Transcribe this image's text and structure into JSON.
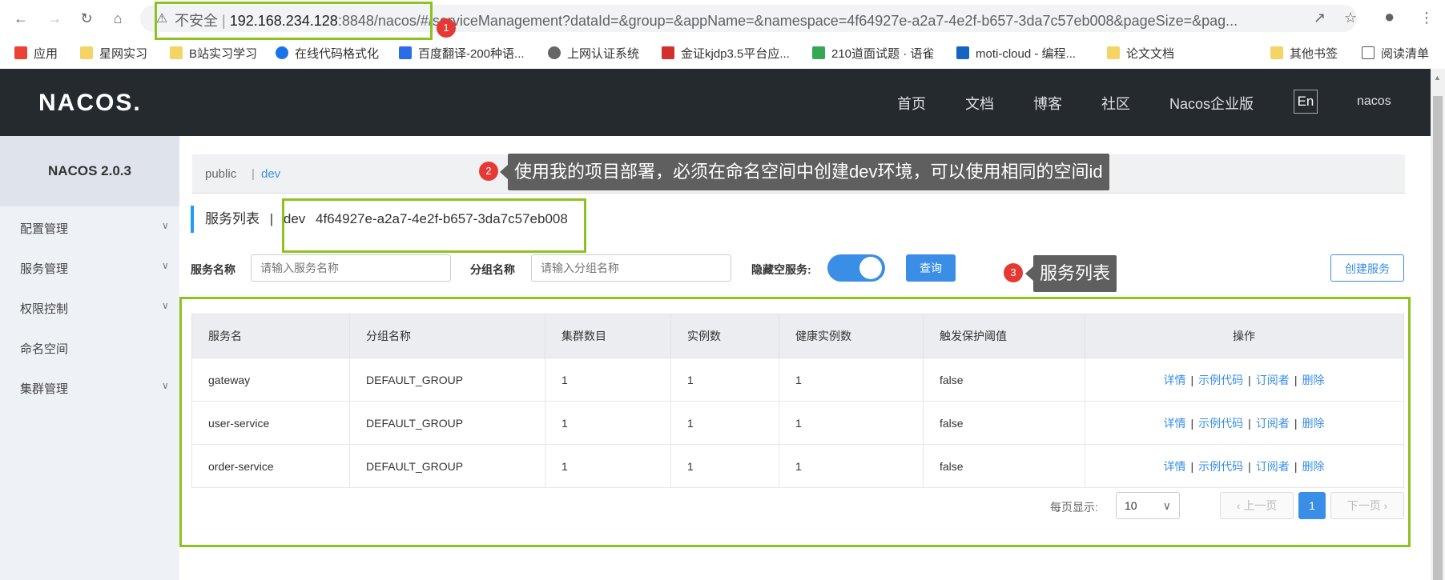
{
  "browser": {
    "security_label": "不安全",
    "url_host": "192.168.234.128",
    "url_rest": ":8848/nacos/#/serviceManagement?dataId=&group=&appName=&namespace=4f64927e-a2a7-4e2f-b657-3da7c57eb008&pageSize=&pag...",
    "bookmarks": [
      "应用",
      "星网实习",
      "B站实习学习",
      "在线代码格式化",
      "百度翻译-200种语...",
      "上网认证系统",
      "金证kjdp3.5平台应...",
      "210道面试题 · 语雀",
      "moti-cloud - 编程...",
      "论文文档",
      "其他书签",
      "阅读清单"
    ]
  },
  "header": {
    "logo": "NACOS.",
    "nav": [
      "首页",
      "文档",
      "博客",
      "社区",
      "Nacos企业版"
    ],
    "lang": "En",
    "user": "nacos"
  },
  "sidebar": {
    "title": "NACOS 2.0.3",
    "items": [
      "配置管理",
      "服务管理",
      "权限控制",
      "命名空间",
      "集群管理"
    ]
  },
  "namespace_bar": {
    "public": "public",
    "separator": "|",
    "dev": "dev"
  },
  "page": {
    "title": "服务列表",
    "title_sep": "|",
    "namespace_name": "dev",
    "namespace_id": "4f64927e-a2a7-4e2f-b657-3da7c57eb008"
  },
  "filters": {
    "service_name_label": "服务名称",
    "service_name_placeholder": "请输入服务名称",
    "group_name_label": "分组名称",
    "group_name_placeholder": "请输入分组名称",
    "hide_empty_label": "隐藏空服务:",
    "query_button": "查询",
    "create_button": "创建服务"
  },
  "table": {
    "headers": [
      "服务名",
      "分组名称",
      "集群数目",
      "实例数",
      "健康实例数",
      "触发保护阈值",
      "操作"
    ],
    "rows": [
      [
        "gateway",
        "DEFAULT_GROUP",
        "1",
        "1",
        "1",
        "false"
      ],
      [
        "user-service",
        "DEFAULT_GROUP",
        "1",
        "1",
        "1",
        "false"
      ],
      [
        "order-service",
        "DEFAULT_GROUP",
        "1",
        "1",
        "1",
        "false"
      ]
    ],
    "ops": [
      "详情",
      "示例代码",
      "订阅者",
      "删除"
    ],
    "op_separator": "|"
  },
  "pagination": {
    "per_page_label": "每页显示:",
    "per_page_value": "10",
    "prev": "上一页",
    "current": "1",
    "next": "下一页"
  },
  "annotations": {
    "badges": [
      "1",
      "2",
      "3"
    ],
    "callout_2": "使用我的项目部署，必须在命名空间中创建dev环境，可以使用相同的空间id",
    "callout_3": "服务列表"
  },
  "colors": {
    "accent": "#3a8ee6",
    "header_bg": "#252a2f",
    "highlight": "#8dc21f",
    "badge": "#e53935"
  }
}
